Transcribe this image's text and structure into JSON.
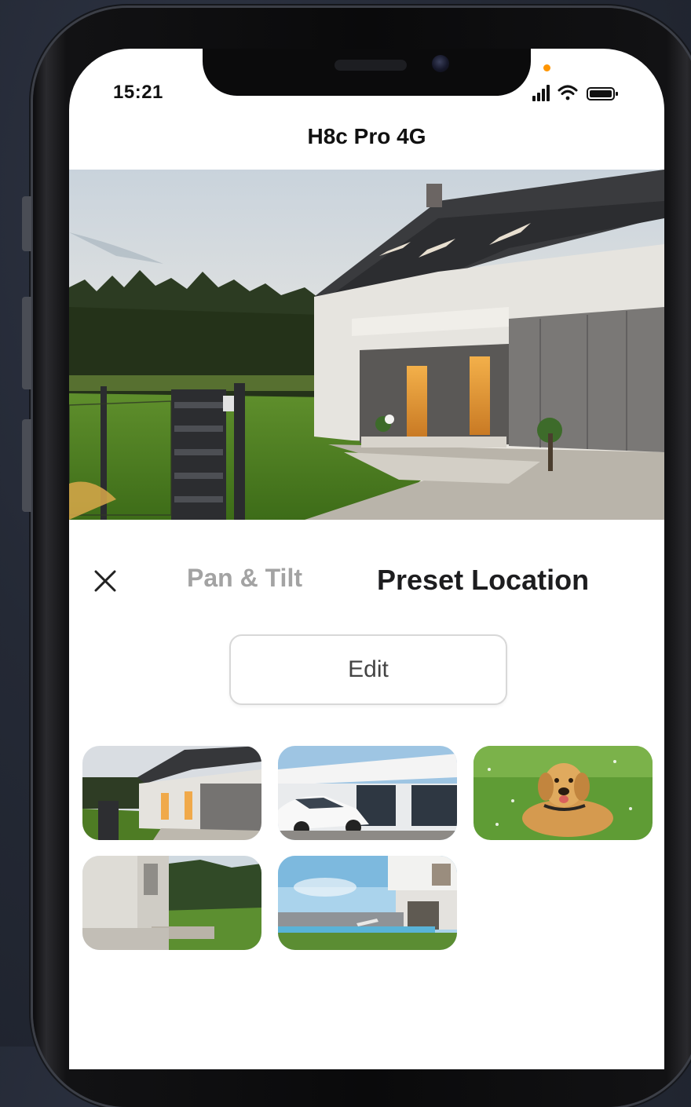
{
  "status_bar": {
    "time": "15:21",
    "icons": [
      "signal-icon",
      "wifi-icon",
      "battery-icon"
    ],
    "privacy_indicator_color": "#ff9500"
  },
  "header": {
    "title": "H8c Pro 4G"
  },
  "live_view": {
    "scene": "house-exterior"
  },
  "controls": {
    "close_icon": "close-icon",
    "tabs": [
      {
        "label": "Pan & Tilt",
        "active": false
      },
      {
        "label": "Preset Location",
        "active": true
      }
    ],
    "edit_label": "Edit"
  },
  "presets": [
    {
      "scene": "house-with-gate"
    },
    {
      "scene": "white-car-garage"
    },
    {
      "scene": "golden-retriever-lawn"
    },
    {
      "scene": "house-side-garden"
    },
    {
      "scene": "modern-house-pool"
    }
  ],
  "colors": {
    "active_tab": "#1d1d1f",
    "inactive_tab": "#a3a3a3",
    "privacy_dot": "#ff9500"
  }
}
